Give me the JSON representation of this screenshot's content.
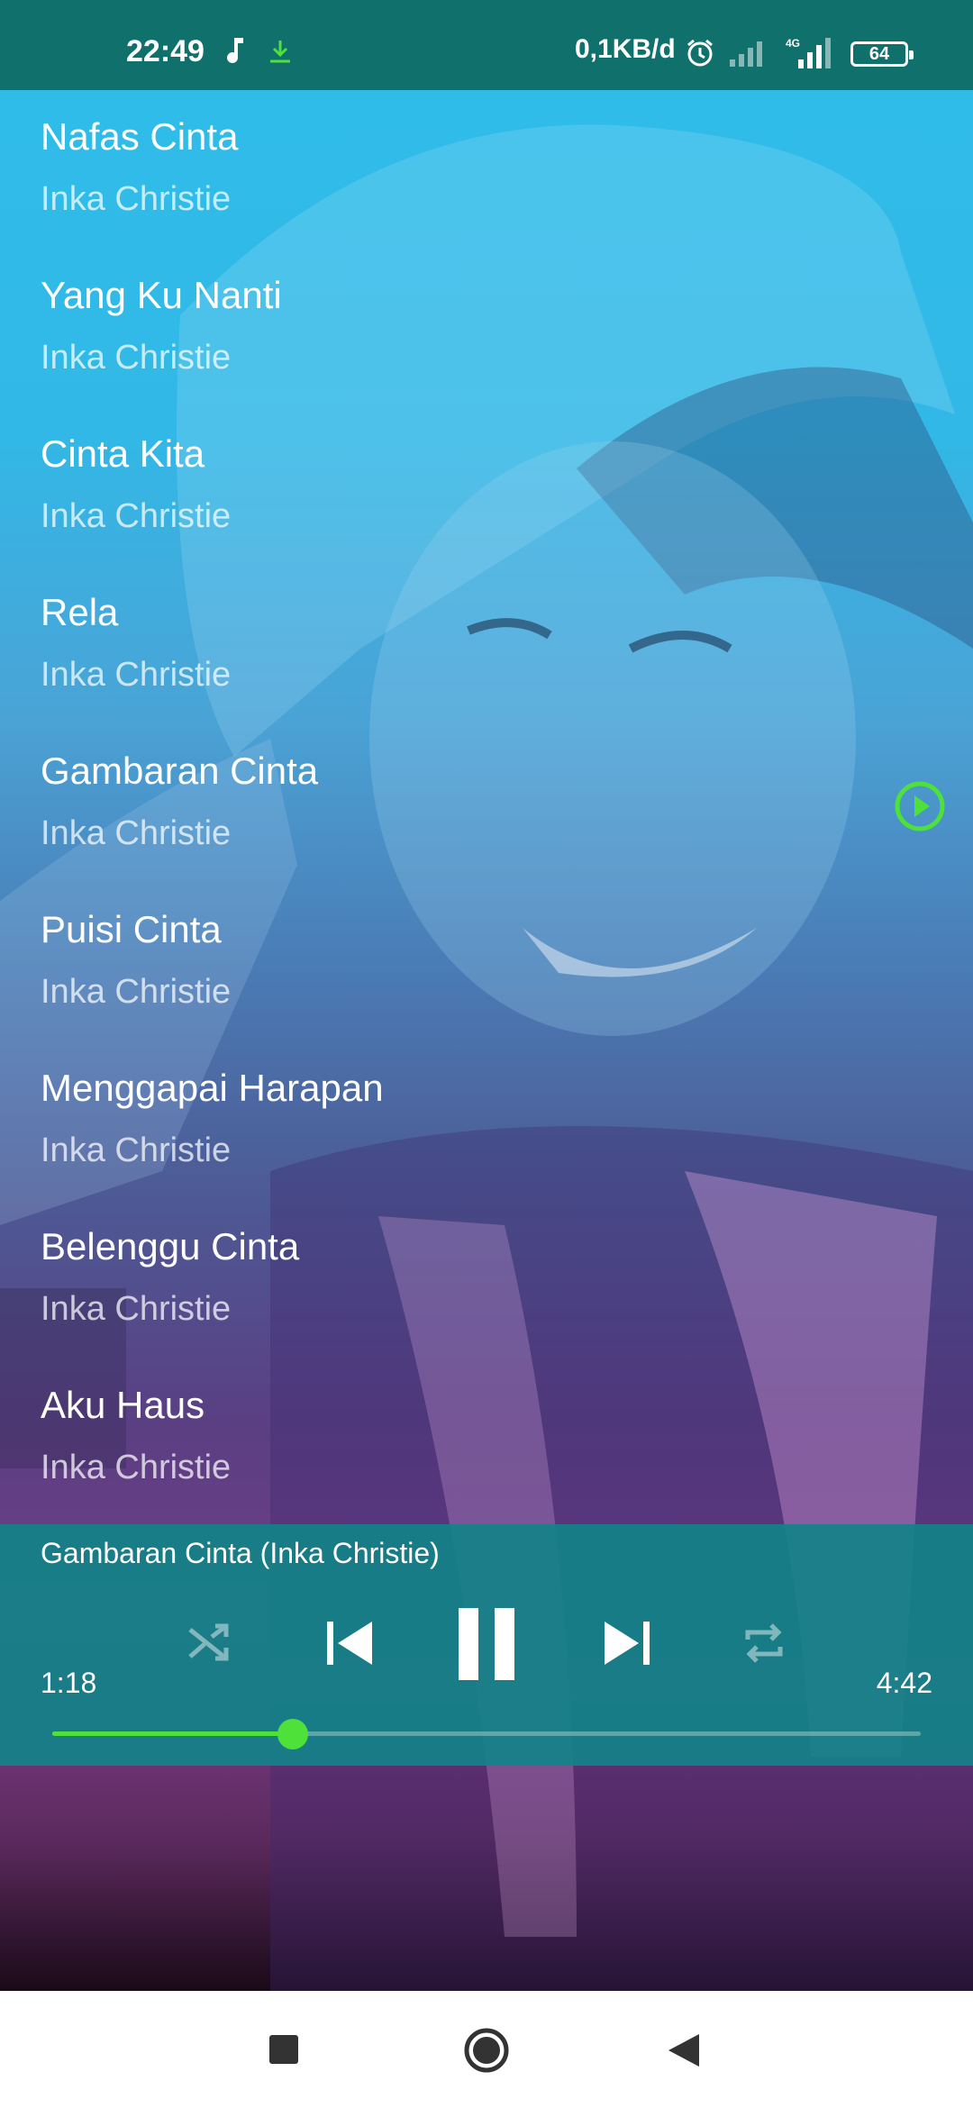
{
  "status_bar": {
    "time": "22:49",
    "network_speed": "0,1KB/d",
    "battery": "64",
    "icons": [
      "music-note-icon",
      "download-icon",
      "alarm-icon",
      "signal-icon",
      "4g-signal-icon",
      "battery-icon"
    ]
  },
  "playlist": {
    "tracks": [
      {
        "title": "Nafas Cinta",
        "artist": "Inka Christie"
      },
      {
        "title": "Yang Ku Nanti",
        "artist": "Inka Christie"
      },
      {
        "title": "Cinta Kita",
        "artist": "Inka Christie"
      },
      {
        "title": "Rela",
        "artist": "Inka Christie"
      },
      {
        "title": "Gambaran Cinta",
        "artist": "Inka Christie",
        "playing": true
      },
      {
        "title": "Puisi Cinta",
        "artist": "Inka Christie"
      },
      {
        "title": "Menggapai Harapan",
        "artist": "Inka Christie"
      },
      {
        "title": "Belenggu Cinta",
        "artist": "Inka Christie"
      },
      {
        "title": "Aku Haus",
        "artist": "Inka Christie"
      }
    ]
  },
  "player": {
    "now_playing": "Gambaran Cinta (Inka Christie)",
    "elapsed": "1:18",
    "duration": "4:42",
    "progress": 0.277,
    "controls": [
      "shuffle-icon",
      "previous-icon",
      "pause-icon",
      "next-icon",
      "repeat-icon"
    ]
  },
  "colors": {
    "status_bar": "#10716c",
    "player_panel": "#128288",
    "accent": "#4ee13a"
  },
  "nav_bar": {
    "buttons": [
      "recents-icon",
      "home-icon",
      "back-icon"
    ]
  }
}
